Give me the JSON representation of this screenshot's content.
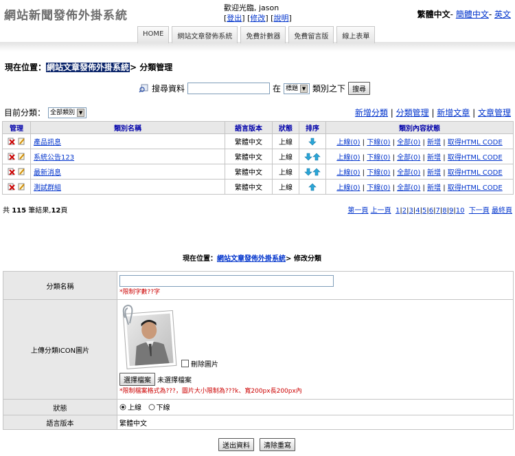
{
  "header": {
    "site_title": "網站新聞發佈外掛系統",
    "welcome": "歡迎光臨, jason",
    "logout": "登出",
    "edit": "修改",
    "help": "說明",
    "lang_current": "繁體中文",
    "lang_simplified": "簡體中文",
    "lang_english": "英文"
  },
  "nav": {
    "tabs": [
      "HOME",
      "網站文章發佈系統",
      "免費計數器",
      "免費留言版",
      "線上表單"
    ]
  },
  "location": {
    "prefix": "現在位置：",
    "system": "網站文章發佈外掛系統",
    "page": "> 分類管理"
  },
  "search": {
    "label": "搜尋資料",
    "in": "在",
    "field_select": "標題",
    "suffix": "類別之下",
    "button": "搜尋"
  },
  "category_bar": {
    "label": "目前分類：",
    "select": "全部類別",
    "links": [
      "新增分類",
      "分類管理",
      "新增文章",
      "文章管理"
    ]
  },
  "table": {
    "headers": [
      "管理",
      "類別名稱",
      "語言版本",
      "狀態",
      "排序",
      "類別內容狀態"
    ],
    "rows": [
      {
        "name": "產品訊息",
        "lang": "繁體中文",
        "status": "上線",
        "sort": "down"
      },
      {
        "name": "系統公告123",
        "lang": "繁體中文",
        "status": "上線",
        "sort": "both"
      },
      {
        "name": "最新消息",
        "lang": "繁體中文",
        "status": "上線",
        "sort": "both"
      },
      {
        "name": "測試群組",
        "lang": "繁體中文",
        "status": "上線",
        "sort": "up"
      }
    ],
    "row_links": [
      "上線(0)",
      "下線(0)",
      "全部(0)",
      "新增",
      "取得HTML CODE"
    ]
  },
  "summary": {
    "text_pre": "共",
    "count": "115",
    "text_mid": "筆結果,",
    "pages": "12",
    "text_post": "頁"
  },
  "pager": {
    "first": "第一頁",
    "prev": "上一頁",
    "pages": [
      "1",
      "2",
      "3",
      "4",
      "5",
      "6",
      "7",
      "8",
      "9",
      "10"
    ],
    "next": "下一頁",
    "last": "最終頁"
  },
  "form_location": {
    "prefix": "現在位置：",
    "system": "網站文章發佈外掛系統",
    "page": "> 修改分類"
  },
  "form": {
    "name_label": "分類名稱",
    "name_hint": "*限制字數??字",
    "icon_label": "上傳分類ICON圖片",
    "delete_image": "刪除圖片",
    "choose_file": "選擇檔案",
    "no_file": "未選擇檔案",
    "file_hint": "*限制檔案格式為???，圖片大小限制為???k、寬200px長200px內",
    "status_label": "狀態",
    "status_online": "上線",
    "status_offline": "下線",
    "lang_label": "語言版本",
    "lang_value": "繁體中文",
    "submit": "送出資料",
    "reset": "清除重寫"
  }
}
